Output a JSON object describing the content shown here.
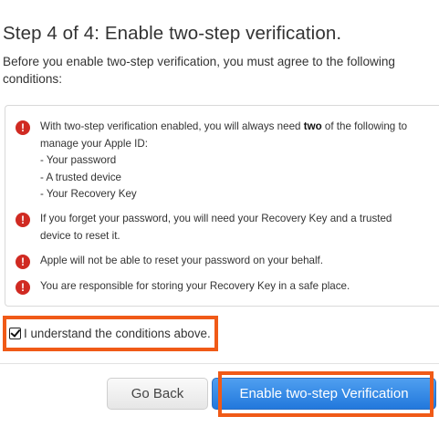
{
  "header": {
    "title": "Step 4 of 4: Enable two-step verification.",
    "intro": "Before you enable two-step verification, you must agree to the following conditions:"
  },
  "conditions": {
    "c1_before": "With two-step verification enabled, you will always need ",
    "c1_bold": "two",
    "c1_after": " of the following to manage your Apple ID:",
    "c1_items": [
      "- Your password",
      "- A trusted device",
      "- Your Recovery Key"
    ],
    "c2": "If you forget your password, you will need your Recovery Key and a trusted device to reset it.",
    "c3": "Apple will not be able to reset your password on your behalf.",
    "c4": "You are responsible for storing your Recovery Key in a safe place.",
    "icon_glyph": "!",
    "icon_color": "#d02a22"
  },
  "agree": {
    "label": "I understand the conditions above.",
    "checked": true
  },
  "actions": {
    "back_label": "Go Back",
    "enable_label": "Enable two-step Verification"
  },
  "colors": {
    "highlight": "#f05a17",
    "primary": "#2278dc"
  }
}
